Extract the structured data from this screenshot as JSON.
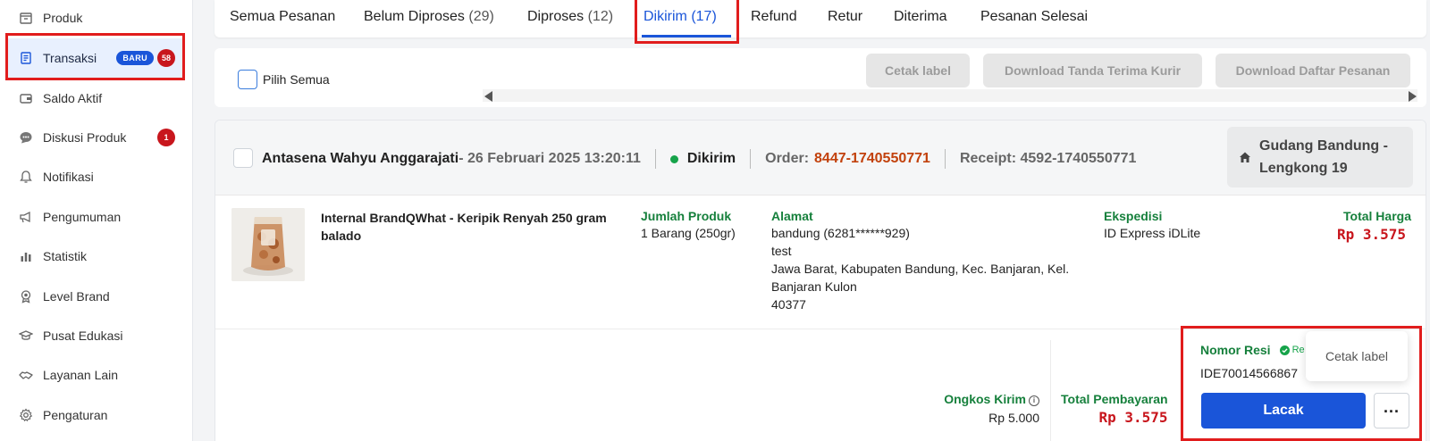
{
  "sidebar": {
    "items": [
      {
        "label": "Produk",
        "icon": "box-icon"
      },
      {
        "label": "Transaksi",
        "icon": "receipt-icon",
        "badge": "BARU",
        "count": "58"
      },
      {
        "label": "Saldo Aktif",
        "icon": "wallet-icon"
      },
      {
        "label": "Diskusi Produk",
        "icon": "chat-icon",
        "count": "1"
      },
      {
        "label": "Notifikasi",
        "icon": "bell-icon"
      },
      {
        "label": "Pengumuman",
        "icon": "megaphone-icon"
      },
      {
        "label": "Statistik",
        "icon": "bar-chart-icon"
      },
      {
        "label": "Level Brand",
        "icon": "medal-icon"
      },
      {
        "label": "Pusat Edukasi",
        "icon": "graduation-cap-icon"
      },
      {
        "label": "Layanan Lain",
        "icon": "handshake-icon"
      },
      {
        "label": "Pengaturan",
        "icon": "gear-icon"
      }
    ]
  },
  "tabs": [
    {
      "label": "Semua Pesanan",
      "count": ""
    },
    {
      "label": "Belum Diproses",
      "count": "(29)"
    },
    {
      "label": "Diproses",
      "count": "(12)"
    },
    {
      "label": "Dikirim",
      "count": "(17)"
    },
    {
      "label": "Refund",
      "count": ""
    },
    {
      "label": "Retur",
      "count": ""
    },
    {
      "label": "Diterima",
      "count": ""
    },
    {
      "label": "Pesanan Selesai",
      "count": ""
    }
  ],
  "actions": {
    "select_all": "Pilih Semua",
    "print_label": "Cetak label",
    "download_receipt": "Download Tanda Terima Kurir",
    "download_list": "Download Daftar Pesanan"
  },
  "order": {
    "buyer": "Antasena Wahyu Anggarajati",
    "date": " - 26 Februari 2025 13:20:11",
    "status": "Dikirim",
    "order_label": "Order:",
    "order_no": "8447-1740550771",
    "receipt": "Receipt: 4592-1740550771",
    "warehouse_line1": "Gudang Bandung -",
    "warehouse_line2": "Lengkong 19",
    "product_name": "Internal BrandQWhat - Keripik Renyah 250 gram balado",
    "qty_label": "Jumlah Produk",
    "qty_value": "1 Barang (250gr)",
    "address_label": "Alamat",
    "address_lines": [
      "bandung (6281******929)",
      "test",
      "Jawa Barat, Kabupaten Bandung, Kec. Banjaran, Kel.",
      "Banjaran Kulon",
      "40377"
    ],
    "courier_label": "Ekspedisi",
    "courier_value": "ID Express iDLite",
    "total_price_label": "Total Harga",
    "total_price": "Rp 3.575",
    "shipping_label": "Ongkos Kirim",
    "shipping_value": "Rp 5.000",
    "payment_label": "Total Pembayaran",
    "payment_value": "Rp 3.575",
    "resi_label": "Nomor Resi",
    "resi_status": "Re",
    "resi_value": "IDE70014566867",
    "track_button": "Lacak",
    "more_button": "...",
    "popup_item": "Cetak label"
  },
  "colors": {
    "accent": "#1a55d9",
    "price": "#c8161d",
    "label_green": "#16803c",
    "order_no": "#c2410c",
    "highlight": "#e11d1d"
  }
}
